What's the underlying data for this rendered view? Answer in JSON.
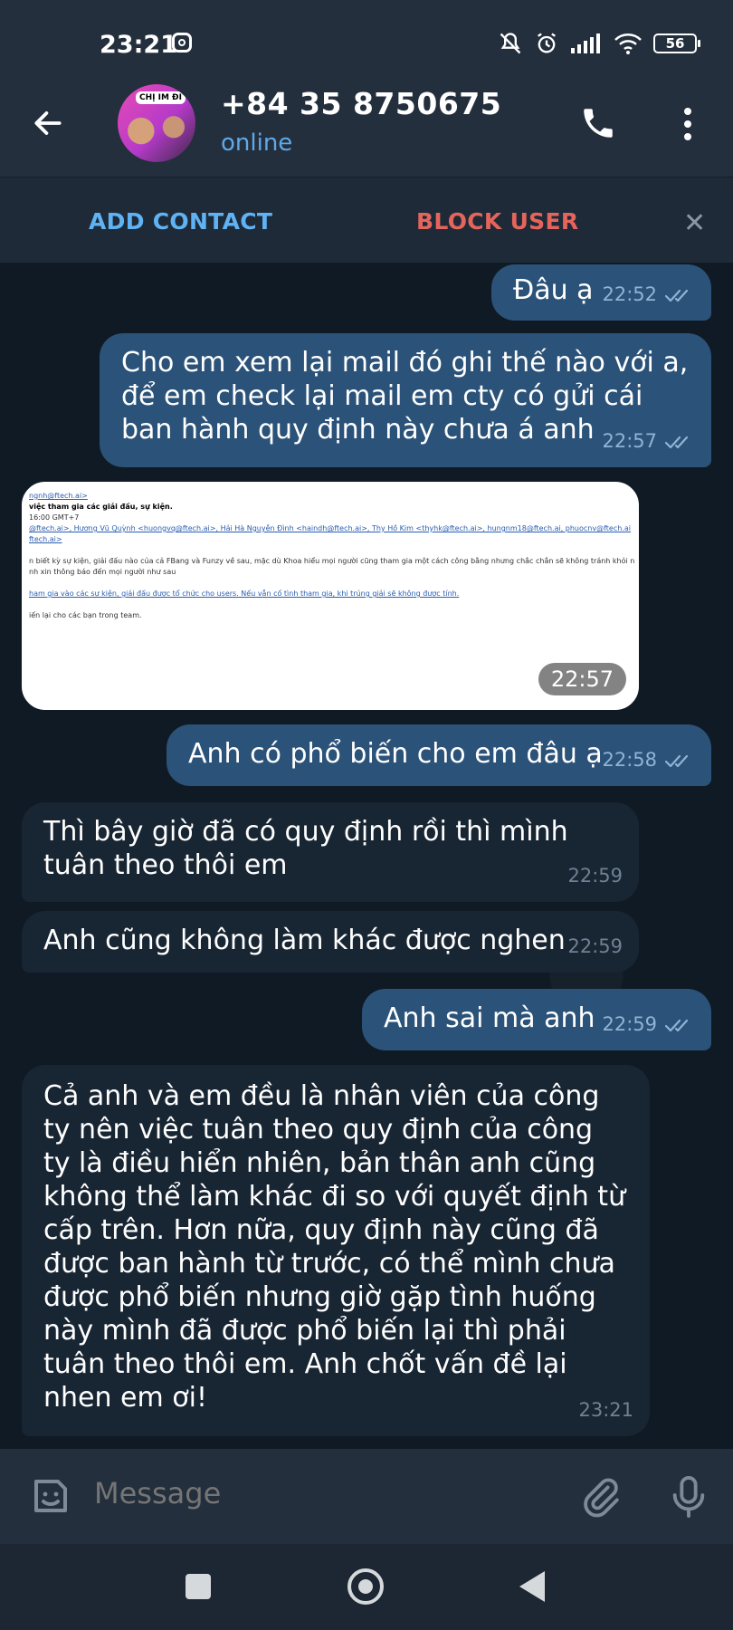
{
  "status_bar": {
    "time": "23:21",
    "battery": "56"
  },
  "header": {
    "contact": "+84 35 8750675",
    "status": "online",
    "avatar_text": "CHỊ IM ĐI"
  },
  "action_bar": {
    "add_contact": "ADD CONTACT",
    "block_user": "BLOCK USER"
  },
  "messages": [
    {
      "dir": "out",
      "text": "Đâu ạ",
      "time": "22:52"
    },
    {
      "dir": "out",
      "text": "Cho em xem lại mail đó ghi thế nào với a, để em check lại mail em cty có gửi cái ban hành quy định này chưa á anh",
      "time": "22:57"
    },
    {
      "dir": "out",
      "type": "photo",
      "time": "22:57"
    },
    {
      "dir": "out",
      "text": "Anh có phổ biến cho em đâu ạ",
      "time": "22:58"
    },
    {
      "dir": "in",
      "text": "Thì bây giờ đã có quy định rồi thì mình tuân theo thôi em",
      "time": "22:59"
    },
    {
      "dir": "in",
      "text": "Anh cũng không làm khác được nghen",
      "time": "22:59"
    },
    {
      "dir": "out",
      "text": "Anh sai mà anh",
      "time": "22:59"
    },
    {
      "dir": "in",
      "text": "Cả anh và em đều là nhân viên của công ty nên việc tuân theo quy định của công ty là điều hiển nhiên, bản thân anh cũng không thể làm khác đi so với quyết định từ cấp trên. Hơn nữa, quy định này cũng đã được ban hành từ trước, có thể mình chưa được phổ biến nhưng giờ gặp tình huống này mình đã được phổ biến lại thì phải tuân theo thôi em. Anh chốt vấn đề lại nhen em ơi!",
      "time": "23:21"
    }
  ],
  "photo_lines": [
    "ngnh@ftech.ai>",
    "việc tham gia các giải đấu, sự kiện.",
    "16:00 GMT+7",
    "@ftech.ai>, Hương Vũ Quỳnh <huongvq@ftech.ai>, Hải Hà Nguyễn Đình <haindh@ftech.ai>, Thy Hồ Kim <thyhk@ftech.ai>, hungnm18@ftech.ai, phuocnv@ftech.ai",
    "ftech.ai>",
    "",
    "n biết kỳ sự kiện, giải đấu nào của cả FBang và Funzy về sau, mặc dù Khoa hiểu mọi người cũng tham gia một cách công bằng nhưng chắc chắn sẽ không tránh khỏi nhi",
    "nh xin thông báo đến mọi người như sau",
    "",
    "ham gia vào các sự kiện, giải đấu được tổ chức cho users. Nếu vẫn cố tình tham gia, khi trúng giải sẽ không được tính.",
    "",
    "iến lại cho các bạn trong team."
  ],
  "input": {
    "placeholder": "Message"
  },
  "colors": {
    "outgoing": "#2b5278",
    "incoming": "#182533",
    "accent": "#5fb3f5",
    "danger": "#e5655c"
  }
}
